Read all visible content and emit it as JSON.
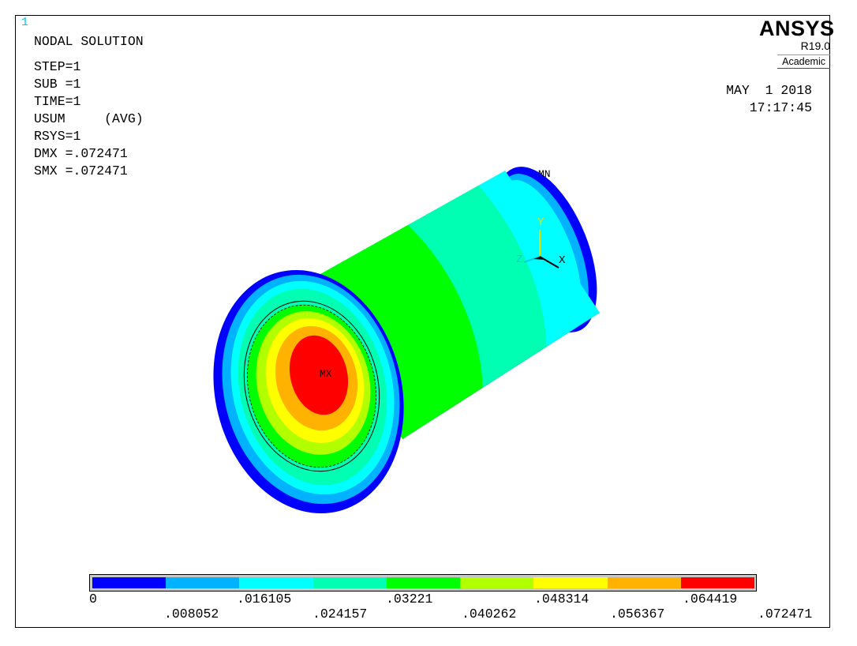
{
  "window_number": "1",
  "header": {
    "title": "NODAL SOLUTION",
    "lines": [
      "STEP=1",
      "SUB =1",
      "TIME=1",
      "USUM     (AVG)",
      "RSYS=1",
      "DMX =.072471",
      "SMX =.072471"
    ]
  },
  "logo": {
    "name": "ANSYS",
    "version": "R19.0",
    "edition": "Academic"
  },
  "datetime": {
    "date": "MAY  1 2018",
    "time": "17:17:45"
  },
  "model_labels": {
    "max": "MX",
    "min": "MN"
  },
  "triad": {
    "x": "X",
    "y": "Y",
    "z": "Z"
  },
  "legend": {
    "colors": [
      "#0000ff",
      "#00b2ff",
      "#00ffff",
      "#00ffb2",
      "#00ff00",
      "#b2ff00",
      "#ffff00",
      "#ffb200",
      "#ff0000"
    ],
    "ticks_top": [
      "0",
      ".016105",
      ".03221",
      ".048314",
      ".064419"
    ],
    "ticks_bottom": [
      ".008052",
      ".024157",
      ".040262",
      ".056367",
      ".072471"
    ]
  }
}
